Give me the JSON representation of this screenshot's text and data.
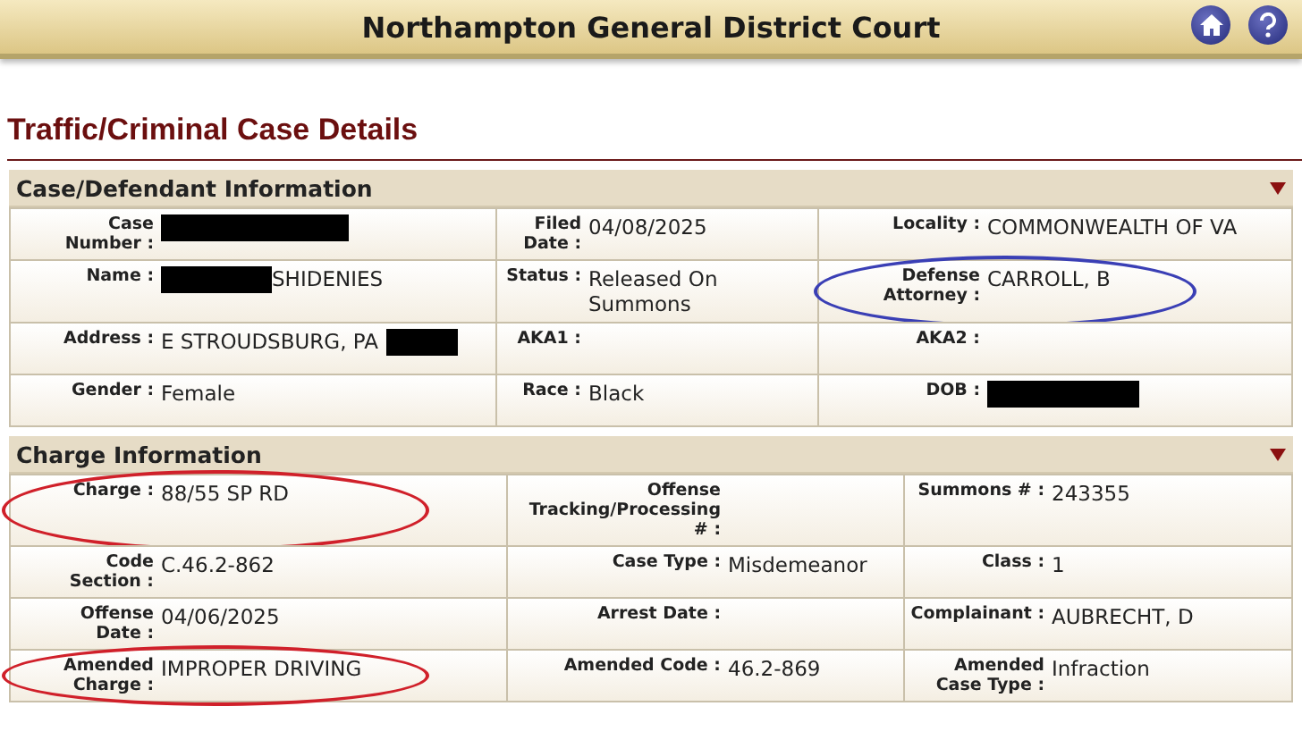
{
  "header": {
    "title": "Northampton General District Court"
  },
  "page_title": "Traffic/Criminal Case Details",
  "sections": [
    {
      "title": "Case/Defendant Information",
      "expanded": true,
      "rows": [
        [
          {
            "label": "Case Number :",
            "value_redacted": true
          },
          {
            "label": "Filed Date :",
            "value": "04/08/2025"
          },
          {
            "label": "Locality :",
            "value": "COMMONWEALTH OF VA"
          }
        ],
        [
          {
            "label": "Name :",
            "value": "SHIDENIES",
            "redacted_before": true
          },
          {
            "label": "Status :",
            "value": "Released On Summons"
          },
          {
            "label": "Defense Attorney :",
            "value": "CARROLL, B",
            "circled": true,
            "color": "#3a3fb5"
          }
        ],
        [
          {
            "label": "Address :",
            "value": "E STROUDSBURG, PA",
            "redacted_after": true
          },
          {
            "label": "AKA1 :"
          },
          {
            "label": "AKA2 :"
          }
        ],
        [
          {
            "label": "Gender :",
            "value": "Female"
          },
          {
            "label": "Race :",
            "value": "Black"
          },
          {
            "label": "DOB :",
            "value_redacted": true
          }
        ]
      ]
    },
    {
      "title": "Charge Information",
      "expanded": true,
      "rows": [
        [
          {
            "label": "Charge :",
            "value": "88/55 SP RD",
            "circled": true,
            "color": "#d0202a"
          },
          {
            "label": "Offense Tracking/Processing # :"
          },
          {
            "label": "Summons # :",
            "value": "243355"
          }
        ],
        [
          {
            "label": "Code Section :",
            "value": "C.46.2-862"
          },
          {
            "label": "Case Type :",
            "value": "Misdemeanor"
          },
          {
            "label": "Class :",
            "value": "1"
          }
        ],
        [
          {
            "label": "Offense Date :",
            "value": "04/06/2025"
          },
          {
            "label": "Arrest Date :"
          },
          {
            "label": "Complainant :",
            "value": "AUBRECHT, D"
          }
        ],
        [
          {
            "label": "Amended Charge :",
            "value": "IMPROPER DRIVING",
            "circled": true,
            "color": "#d0202a"
          },
          {
            "label": "Amended Code :",
            "value": "46.2-869"
          },
          {
            "label": "Amended Case Type :",
            "value": "Infraction"
          }
        ]
      ]
    }
  ]
}
